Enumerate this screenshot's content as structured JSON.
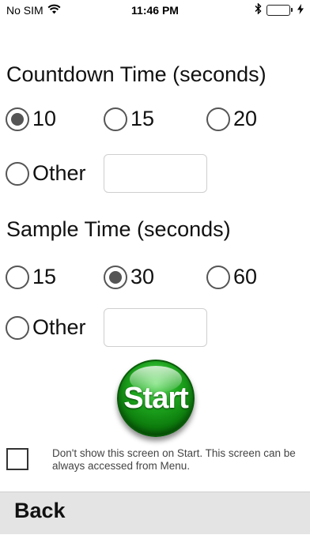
{
  "status_bar": {
    "carrier": "No SIM",
    "wifi_icon": "wifi-icon",
    "time": "11:46 PM",
    "bluetooth_icon": "bluetooth-icon",
    "battery_icon": "battery-icon",
    "charging_icon": "charging-bolt-icon",
    "battery_color": "#35c24a"
  },
  "countdown": {
    "title": "Countdown Time (seconds)",
    "options": [
      {
        "label": "10",
        "selected": true
      },
      {
        "label": "15",
        "selected": false
      },
      {
        "label": "20",
        "selected": false
      },
      {
        "label": "Other",
        "selected": false
      }
    ],
    "other_value": ""
  },
  "sample": {
    "title": "Sample Time (seconds)",
    "options": [
      {
        "label": "15",
        "selected": false
      },
      {
        "label": "30",
        "selected": true
      },
      {
        "label": "60",
        "selected": false
      },
      {
        "label": "Other",
        "selected": false
      }
    ],
    "other_value": ""
  },
  "start_button": {
    "label": "Start",
    "color": "#1fa81f"
  },
  "dont_show": {
    "checked": false,
    "text": "Don't show this screen on Start.  This screen can be always accessed from Menu."
  },
  "bottom_bar": {
    "back_label": "Back"
  }
}
